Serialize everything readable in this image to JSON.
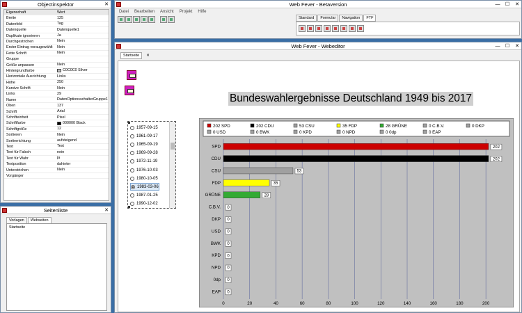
{
  "inspector": {
    "title": "Objectinspektor",
    "header": {
      "key": "Eigenschaft",
      "value": "Wert"
    },
    "rows": [
      {
        "k": "Breite",
        "v": "125"
      },
      {
        "k": "Datenfeld",
        "v": "Tag"
      },
      {
        "k": "Datenquelle",
        "v": "Datenquelle1"
      },
      {
        "k": "Duplikate ignorieren",
        "v": "Ja"
      },
      {
        "k": "Durchgestrichen",
        "v": "Nein"
      },
      {
        "k": "Erster Eintrag voraugewählt",
        "v": "Nein"
      },
      {
        "k": "Fette Schrift",
        "v": "Nein"
      },
      {
        "k": "Gruppe",
        "v": ""
      },
      {
        "k": "Größe anpassen",
        "v": "Nein"
      },
      {
        "k": "Hintergrundfarbe",
        "v": "C0C0C0 Silver",
        "swatch": "#c0c0c0"
      },
      {
        "k": "Horizontale Ausrichtung",
        "v": "Links"
      },
      {
        "k": "Höhe",
        "v": "250"
      },
      {
        "k": "Kursive Schrift",
        "v": "Nein"
      },
      {
        "k": "Links",
        "v": "29"
      },
      {
        "k": "Name",
        "v": "DatenOptionsschalterGruppe1"
      },
      {
        "k": "Oben",
        "v": "137"
      },
      {
        "k": "Schrift",
        "v": "Arial"
      },
      {
        "k": "Schrifteinheit",
        "v": "Pixel"
      },
      {
        "k": "Schriftfarbe",
        "v": "000000 Black",
        "swatch": "#000000"
      },
      {
        "k": "Schriftgröße",
        "v": "12"
      },
      {
        "k": "Sortieren",
        "v": "Nein"
      },
      {
        "k": "Sortierrichtung",
        "v": "aufsteigend"
      },
      {
        "k": "Text",
        "v": "Text"
      },
      {
        "k": "Text für Falsch",
        "v": "nein"
      },
      {
        "k": "Text für Wahr",
        "v": "ja"
      },
      {
        "k": "Textposition",
        "v": "dahinter"
      },
      {
        "k": "Unterstrichen",
        "v": "Nein"
      },
      {
        "k": "Vorgänger",
        "v": ""
      }
    ]
  },
  "seitenliste": {
    "title": "Seitenliste",
    "tabs": [
      "Vorlagen",
      "Webseiten"
    ],
    "items": [
      "Startseite"
    ]
  },
  "main": {
    "title": "Web Fever - Betaversion",
    "menu": [
      "Datei",
      "Bearbeiten",
      "Ansicht",
      "Projekt",
      "Hilfe"
    ],
    "ribbon_tabs": [
      "Standard",
      "Formular",
      "Navigation",
      "FTF"
    ],
    "active_ribbon_tab": "FTF"
  },
  "editor": {
    "title": "Web Fever - Webeditor",
    "page_tab": "Startseite",
    "close_glyph": "✕",
    "chart_title": "Bundeswahlergebnisse Deutschland 1949 bis 2017",
    "dates": [
      "1957-09-15",
      "1961-09-17",
      "1965-09-19",
      "1969-09-28",
      "1972-11-19",
      "1976-10-03",
      "1980-10-05",
      "1983-03-06",
      "1987-01-25",
      "1990-12-02"
    ],
    "selected_date": "1983-03-06"
  },
  "window_controls": {
    "min": "—",
    "max": "☐",
    "close": "✕"
  },
  "chart_data": {
    "type": "bar",
    "orientation": "horizontal",
    "categories": [
      "SPD",
      "CDU",
      "CSU",
      "FDP",
      "GRÜNE",
      "C.B.V.",
      "DKP",
      "USD",
      "BWK",
      "KPD",
      "NPD",
      "0dp",
      "EAP"
    ],
    "values": [
      202,
      202,
      53,
      35,
      28,
      0,
      0,
      0,
      0,
      0,
      0,
      0,
      0
    ],
    "colors": [
      "#cc0000",
      "#000000",
      "#a0a0a0",
      "#ffff00",
      "#33aa33",
      "#a0a0a0",
      "#a0a0a0",
      "#a0a0a0",
      "#a0a0a0",
      "#a0a0a0",
      "#a0a0a0",
      "#a0a0a0",
      "#a0a0a0"
    ],
    "legend": [
      {
        "label": "202 SPD",
        "color": "#cc0000"
      },
      {
        "label": "202 CDU",
        "color": "#000000"
      },
      {
        "label": "53 CSU",
        "color": "#a0a0a0"
      },
      {
        "label": "35 FDP",
        "color": "#ffff00"
      },
      {
        "label": "28 GRÜNE",
        "color": "#33aa33"
      },
      {
        "label": "0 C.B.V.",
        "color": "#a0a0a0"
      },
      {
        "label": "0 DKP",
        "color": "#a0a0a0"
      },
      {
        "label": "0 USD",
        "color": "#a0a0a0"
      },
      {
        "label": "0 BWK",
        "color": "#a0a0a0"
      },
      {
        "label": "0 KPD",
        "color": "#a0a0a0"
      },
      {
        "label": "0 NPD",
        "color": "#a0a0a0"
      },
      {
        "label": "0 0dp",
        "color": "#a0a0a0"
      },
      {
        "label": "0 EAP",
        "color": "#a0a0a0"
      }
    ],
    "legend_position": "top",
    "xlim": [
      0,
      210
    ],
    "xticks": [
      0,
      20,
      40,
      60,
      80,
      100,
      120,
      140,
      160,
      180,
      200
    ],
    "grid": true,
    "background": "#c0c0c0"
  }
}
